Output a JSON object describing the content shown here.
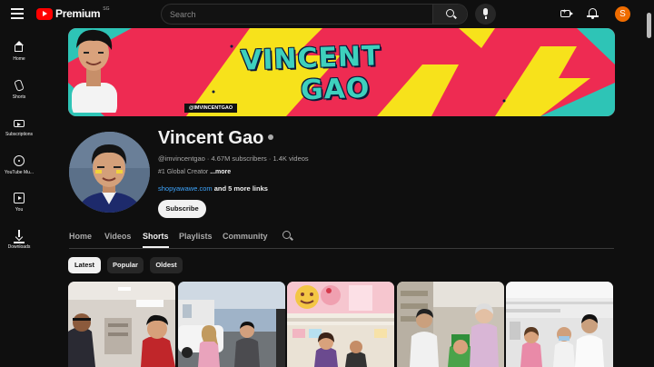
{
  "app": {
    "brand": "Premium",
    "region": "SG",
    "user_initial": "S"
  },
  "search": {
    "placeholder": "Search"
  },
  "sidebar": {
    "items": [
      {
        "label": "Home",
        "icon": "home-icon"
      },
      {
        "label": "Shorts",
        "icon": "shorts-icon"
      },
      {
        "label": "Subscriptions",
        "icon": "subscriptions-icon"
      },
      {
        "label": "YouTube Mu...",
        "icon": "youtube-music-icon"
      },
      {
        "label": "You",
        "icon": "you-icon"
      },
      {
        "label": "Downloads",
        "icon": "download-icon"
      }
    ]
  },
  "banner": {
    "title_line1": "VINCENT",
    "title_line2": "GAO",
    "handle": "@IMVINCENTGAO"
  },
  "channel": {
    "name": "Vincent Gao",
    "handle": "@imvincentgao",
    "subscribers": "4.67M subscribers",
    "videos": "1.4K videos",
    "separator": "·",
    "description": "#1 Global Creator",
    "more_label": "...more",
    "link": "shopyawawe.com",
    "more_links": "and 5 more links",
    "subscribe_label": "Subscribe"
  },
  "tabs": [
    {
      "label": "Home",
      "active": false
    },
    {
      "label": "Videos",
      "active": false
    },
    {
      "label": "Shorts",
      "active": true
    },
    {
      "label": "Playlists",
      "active": false
    },
    {
      "label": "Community",
      "active": false
    }
  ],
  "filters": [
    {
      "label": "Latest",
      "active": true
    },
    {
      "label": "Popular",
      "active": false
    },
    {
      "label": "Oldest",
      "active": false
    }
  ],
  "colors": {
    "background": "#0f0f0f",
    "brand_red": "#ff0000",
    "avatar_orange": "#ef6c00",
    "link_blue": "#3ea6ff",
    "banner_red": "#ee2b52",
    "banner_teal": "#3ed0bd",
    "banner_yellow": "#f7e21b"
  }
}
